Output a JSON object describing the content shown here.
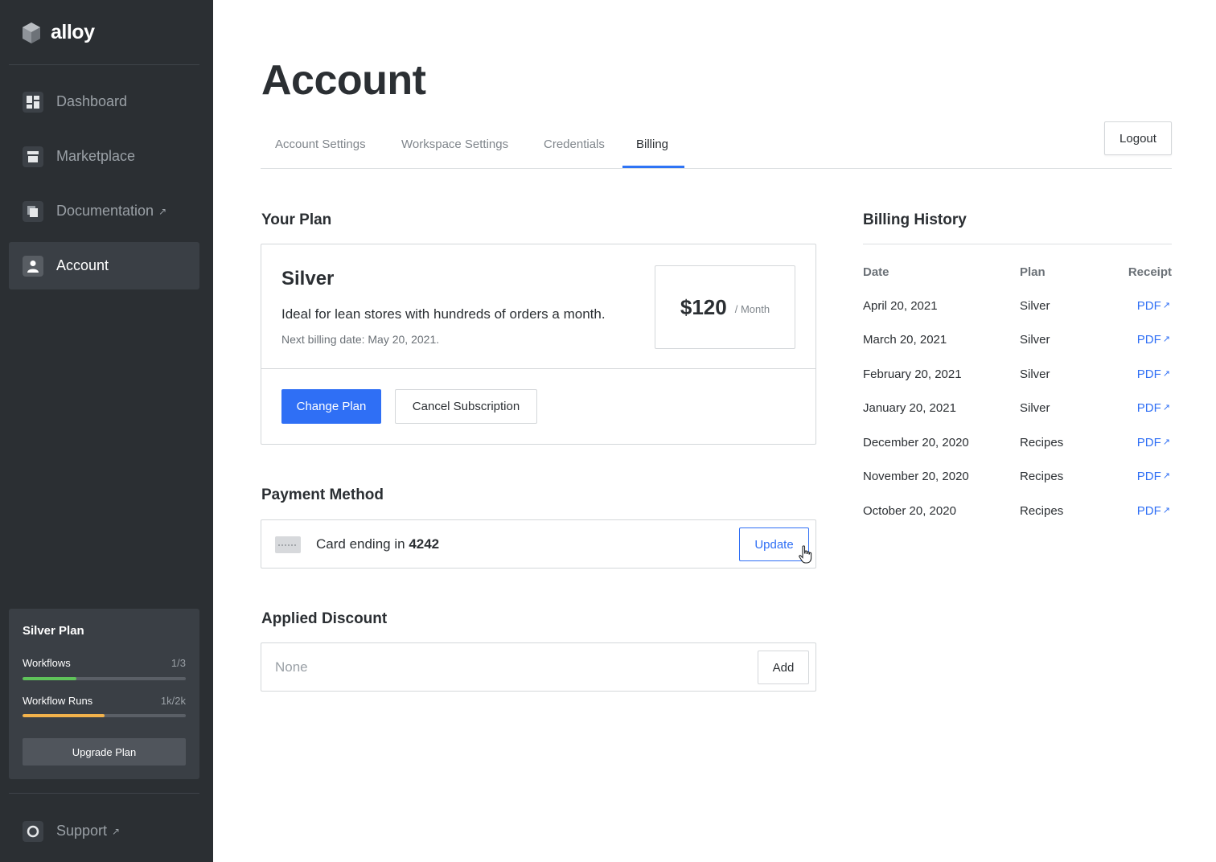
{
  "app": {
    "name": "alloy"
  },
  "sidebar": {
    "nav": [
      {
        "label": "Dashboard",
        "icon": "dashboard-icon",
        "external": false,
        "active": false
      },
      {
        "label": "Marketplace",
        "icon": "store-icon",
        "external": false,
        "active": false
      },
      {
        "label": "Documentation",
        "icon": "docs-icon",
        "external": true,
        "active": false
      },
      {
        "label": "Account",
        "icon": "user-icon",
        "external": false,
        "active": true
      }
    ],
    "plan": {
      "title": "Silver Plan",
      "workflows_label": "Workflows",
      "workflows_value": "1/3",
      "workflows_fraction": 0.33,
      "runs_label": "Workflow Runs",
      "runs_value": "1k/2k",
      "runs_fraction": 0.5,
      "upgrade_label": "Upgrade Plan"
    },
    "support_label": "Support",
    "colors": {
      "workflows_bar": "#5fc35a",
      "runs_bar": "#f2b24b"
    }
  },
  "header": {
    "title": "Account",
    "tabs": [
      {
        "label": "Account Settings",
        "active": false
      },
      {
        "label": "Workspace Settings",
        "active": false
      },
      {
        "label": "Credentials",
        "active": false
      },
      {
        "label": "Billing",
        "active": true
      }
    ],
    "logout_label": "Logout"
  },
  "your_plan": {
    "section_title": "Your Plan",
    "name": "Silver",
    "description": "Ideal for lean stores with hundreds of orders a month.",
    "next_billing": "Next billing date: May 20, 2021.",
    "price": "$120",
    "price_unit": "/ Month",
    "change_label": "Change Plan",
    "cancel_label": "Cancel Subscription"
  },
  "payment": {
    "section_title": "Payment Method",
    "card_prefix": "Card ending in",
    "card_last4": "4242",
    "update_label": "Update"
  },
  "discount": {
    "section_title": "Applied Discount",
    "placeholder": "None",
    "add_label": "Add"
  },
  "billing_history": {
    "title": "Billing History",
    "columns": [
      "Date",
      "Plan",
      "Receipt"
    ],
    "rows": [
      {
        "date": "April 20, 2021",
        "plan": "Silver",
        "receipt": "PDF"
      },
      {
        "date": "March 20, 2021",
        "plan": "Silver",
        "receipt": "PDF"
      },
      {
        "date": "February 20, 2021",
        "plan": "Silver",
        "receipt": "PDF"
      },
      {
        "date": "January 20, 2021",
        "plan": "Silver",
        "receipt": "PDF"
      },
      {
        "date": "December 20, 2020",
        "plan": "Recipes",
        "receipt": "PDF"
      },
      {
        "date": "November 20, 2020",
        "plan": "Recipes",
        "receipt": "PDF"
      },
      {
        "date": "October 20, 2020",
        "plan": "Recipes",
        "receipt": "PDF"
      }
    ]
  },
  "accent_color": "#2f6ff5"
}
